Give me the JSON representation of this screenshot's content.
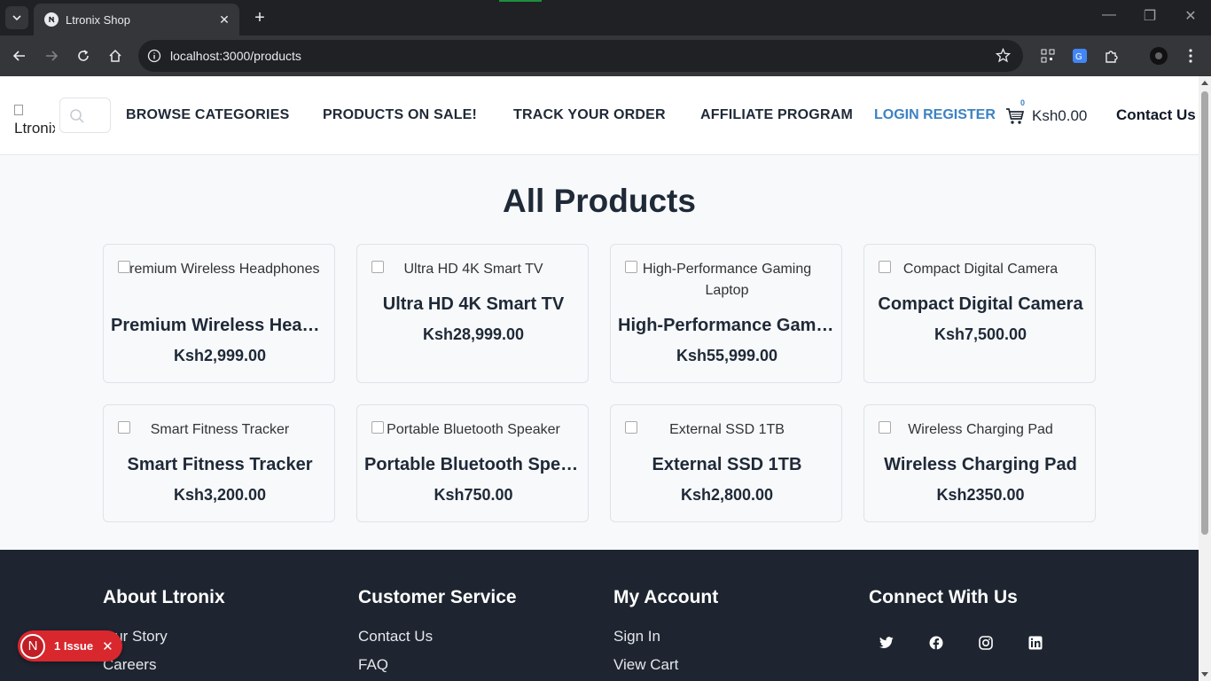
{
  "browser": {
    "tab_title": "Ltronix Shop",
    "url": "localhost:3000/products"
  },
  "header": {
    "logo_alt": "Ltronix",
    "nav": [
      "BROWSE CATEGORIES",
      "PRODUCTS ON SALE!",
      "TRACK YOUR ORDER",
      "AFFILIATE PROGRAM"
    ],
    "login_register": "LOGIN REGISTER",
    "cart_count": "0",
    "cart_total": "Ksh0.00",
    "contact": "Contact Us"
  },
  "main": {
    "title": "All Products",
    "products": [
      {
        "alt": "Premium Wireless Headphones",
        "name": "Premium Wireless Headphones",
        "price": "Ksh2,999.00"
      },
      {
        "alt": "Ultra HD 4K Smart TV",
        "name": "Ultra HD 4K Smart TV",
        "price": "Ksh28,999.00"
      },
      {
        "alt": "High-Performance Gaming Laptop",
        "name": "High-Performance Gaming Laptop",
        "price": "Ksh55,999.00"
      },
      {
        "alt": "Compact Digital Camera",
        "name": "Compact Digital Camera",
        "price": "Ksh7,500.00"
      },
      {
        "alt": "Smart Fitness Tracker",
        "name": "Smart Fitness Tracker",
        "price": "Ksh3,200.00"
      },
      {
        "alt": "Portable Bluetooth Speaker",
        "name": "Portable Bluetooth Speaker",
        "price": "Ksh750.00"
      },
      {
        "alt": "External SSD 1TB",
        "name": "External SSD 1TB",
        "price": "Ksh2,800.00"
      },
      {
        "alt": "Wireless Charging Pad",
        "name": "Wireless Charging Pad",
        "price": "Ksh2350.00"
      }
    ]
  },
  "footer": {
    "about": {
      "title": "About Ltronix",
      "links": [
        "Our Story",
        "Careers"
      ]
    },
    "service": {
      "title": "Customer Service",
      "links": [
        "Contact Us",
        "FAQ"
      ]
    },
    "account": {
      "title": "My Account",
      "links": [
        "Sign In",
        "View Cart"
      ]
    },
    "connect": {
      "title": "Connect With Us",
      "icons": [
        "twitter-icon",
        "facebook-icon",
        "instagram-icon",
        "linkedin-icon"
      ]
    }
  },
  "devtools": {
    "badge_letter": "N",
    "issues": "1 Issue"
  }
}
